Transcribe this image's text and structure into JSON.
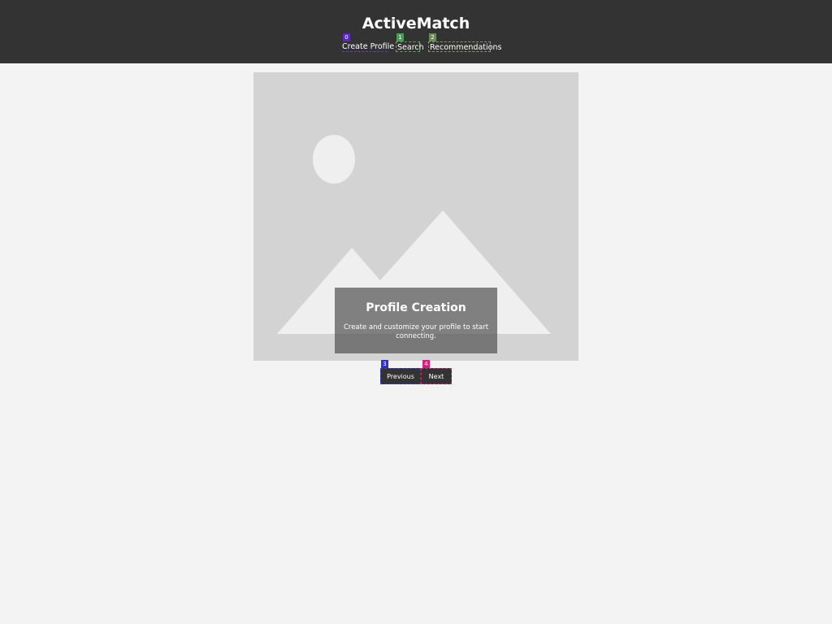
{
  "header": {
    "title": "ActiveMatch",
    "nav": [
      {
        "label": "Create Profile",
        "marker": "0"
      },
      {
        "label": "Search",
        "marker": "1"
      },
      {
        "label": "Recommendations",
        "marker": "2"
      }
    ]
  },
  "carousel": {
    "image_icon": "image-placeholder-icon",
    "caption_title": "Profile Creation",
    "caption_text": "Create and customize your profile to start connecting."
  },
  "controls": {
    "previous": {
      "label": "Previous",
      "marker": "3"
    },
    "next": {
      "label": "Next",
      "marker": "4"
    }
  },
  "colors": {
    "header_bg": "#333333",
    "page_bg": "#f3f3f3",
    "placeholder_bg": "#d3d3d3",
    "placeholder_shape": "#efefef",
    "marker_0": "#5b2ab8",
    "marker_1": "#4f9a55",
    "marker_2": "#6c8a5a",
    "marker_3": "#2d2fd0",
    "marker_4": "#d0237c"
  }
}
